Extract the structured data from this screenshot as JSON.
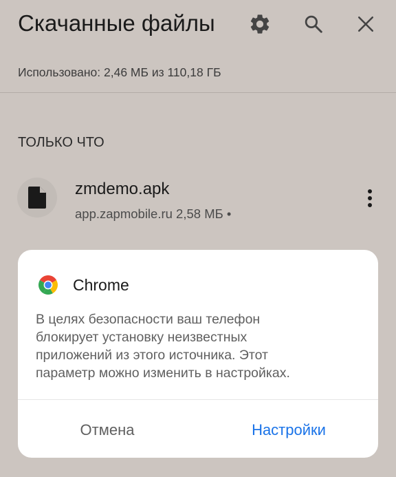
{
  "header": {
    "title": "Скачанные файлы",
    "icons": [
      "gear-icon",
      "search-icon",
      "close-icon"
    ]
  },
  "storage": {
    "text": "Использовано: 2,46 МБ из 110,18 ГБ"
  },
  "section": {
    "label": "ТОЛЬКО ЧТО"
  },
  "file": {
    "name": "zmdemo.apk",
    "meta": "app.zapmobile.ru 2,58 МБ •",
    "icon": "file-icon"
  },
  "dialog": {
    "app_name": "Chrome",
    "message_lines": [
      "В целях безопасности ваш телефон",
      "блокирует установку неизвестных",
      "приложений из этого источника. Этот",
      "параметр можно изменить в настройках."
    ],
    "cancel_label": "Отмена",
    "settings_label": "Настройки"
  },
  "colors": {
    "background": "#ccc5c0",
    "accent": "#1a73e8",
    "dialog_bg": "#ffffff"
  }
}
